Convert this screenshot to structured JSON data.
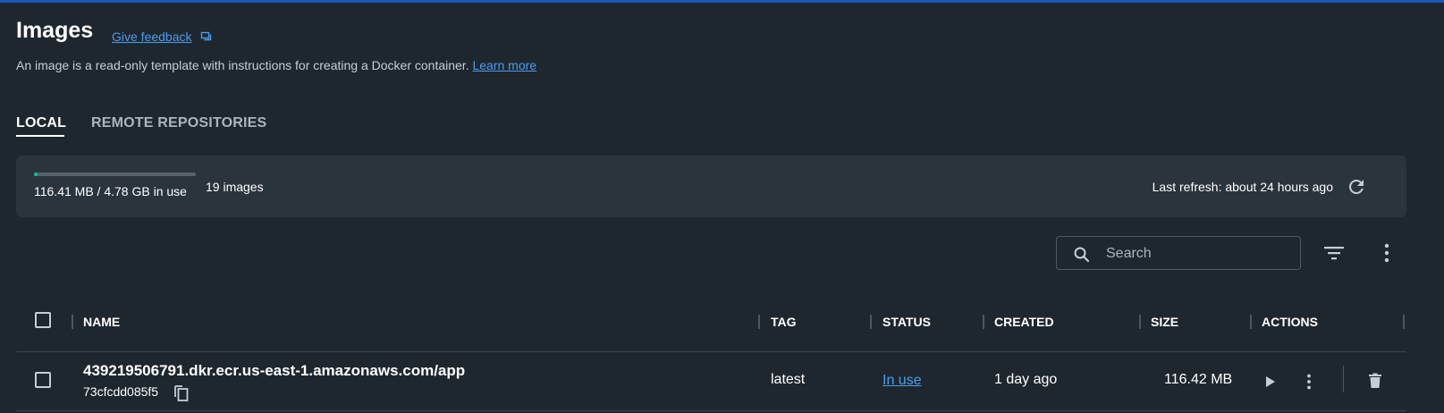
{
  "header": {
    "title": "Images",
    "feedback_label": "Give feedback",
    "feedback_icon": "feedback-icon",
    "subtitle": "An image is a read-only template with instructions for creating a Docker container. ",
    "learn_more_label": "Learn more"
  },
  "tabs": [
    {
      "label": "LOCAL",
      "active": true
    },
    {
      "label": "REMOTE REPOSITORIES",
      "active": false
    }
  ],
  "usage": {
    "text": "116.41 MB / 4.78 GB in use",
    "used_fraction": 0.024,
    "images_count": "19 images",
    "last_refresh": "Last refresh: about 24 hours ago"
  },
  "toolbar": {
    "search_placeholder": "Search",
    "search_value": ""
  },
  "table": {
    "columns": [
      "NAME",
      "TAG",
      "STATUS",
      "CREATED",
      "SIZE",
      "ACTIONS"
    ],
    "rows": [
      {
        "name": "439219506791.dkr.ecr.us-east-1.amazonaws.com/app",
        "id": "73cfcdd085f5",
        "tag": "latest",
        "status": "In use",
        "created": "1 day ago",
        "size": "116.42 MB"
      }
    ]
  },
  "colors": {
    "background": "#1f272e",
    "panel": "#2a343d",
    "accent": "#1b57b8",
    "link": "#4a9df0",
    "progress": "#13bf9e"
  }
}
